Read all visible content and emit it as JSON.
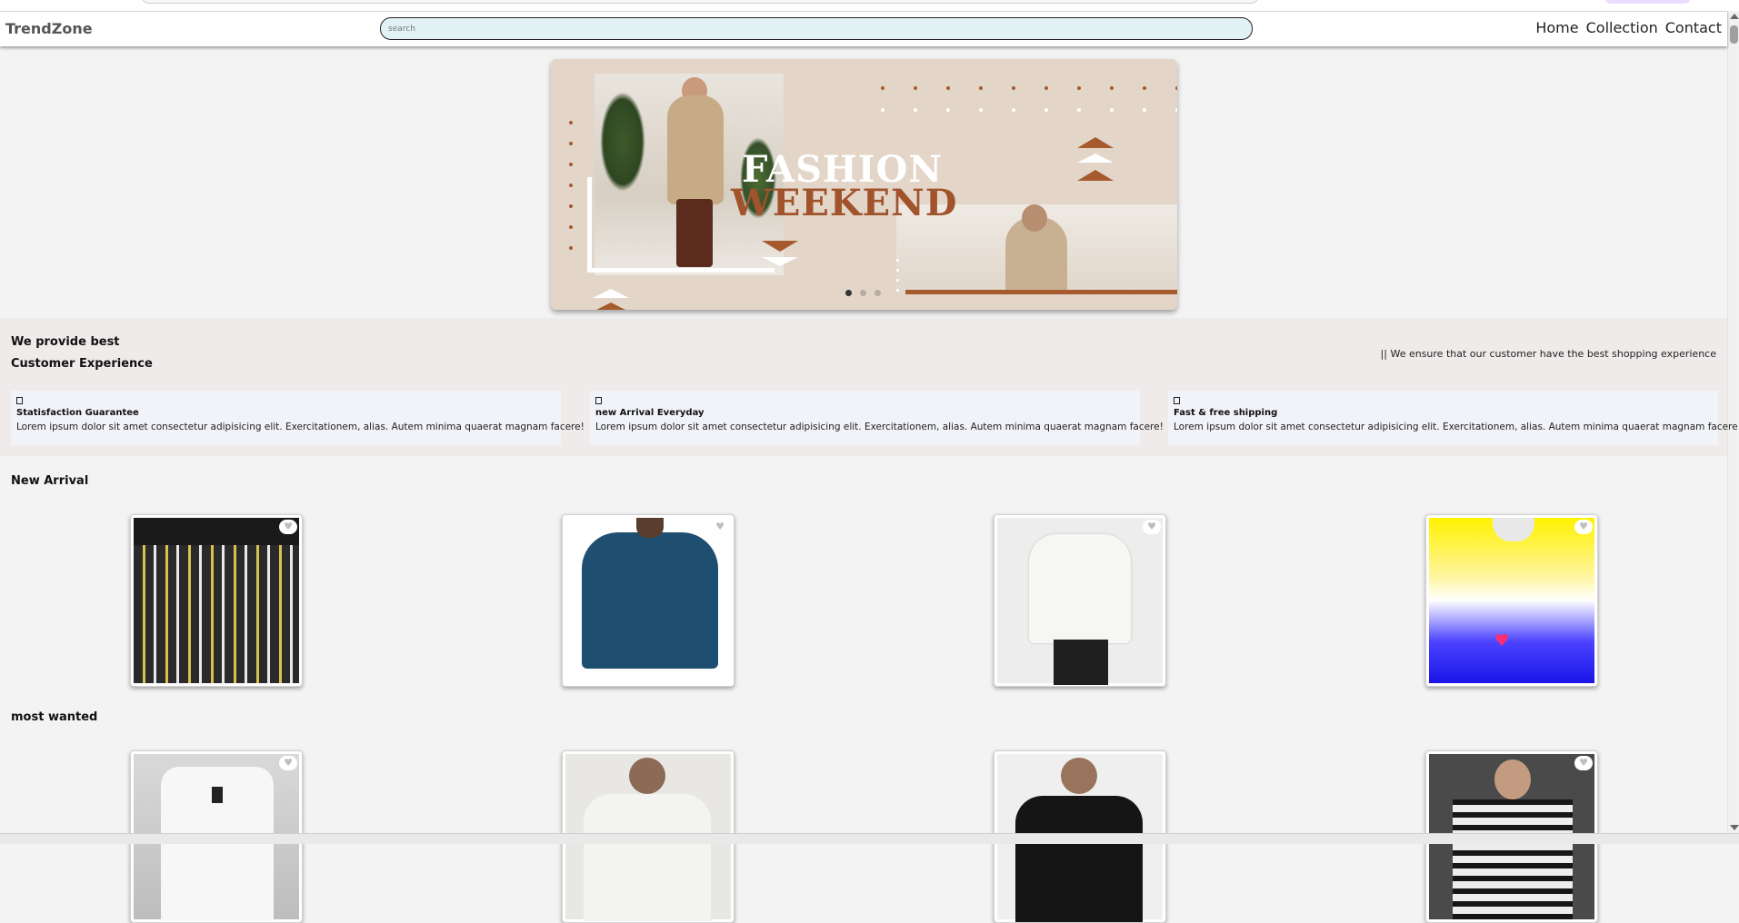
{
  "navbar": {
    "brand": "TrendZone",
    "search_placeholder": "search",
    "links": [
      "Home",
      "Collection",
      "Contact"
    ]
  },
  "hero": {
    "title_line1": "FASHION",
    "title_line2": "WEEKEND",
    "slides_count": 3,
    "active_slide": 1,
    "colors": {
      "background": "#e3d6c8",
      "accent": "#a1532b"
    }
  },
  "experience": {
    "heading_line1": "We provide best",
    "heading_line2": "Customer Experience",
    "tagline": "|| We ensure that our customer have the best shopping experience",
    "features": [
      {
        "icon": "guarantee-icon",
        "title": "Statisfaction Guarantee",
        "description": "Lorem ipsum dolor sit amet consectetur adipisicing elit. Exercitationem, alias. Autem minima quaerat magnam facere!"
      },
      {
        "icon": "new-arrival-icon",
        "title": "new Arrival Everyday",
        "description": "Lorem ipsum dolor sit amet consectetur adipisicing elit. Exercitationem, alias. Autem minima quaerat magnam facere!"
      },
      {
        "icon": "shipping-icon",
        "title": "Fast & free shipping",
        "description": "Lorem ipsum dolor sit amet consectetur adipisicing elit. Exercitationem, alias. Autem minima quaerat magnam facere!"
      }
    ]
  },
  "sections": {
    "new_arrival": {
      "title": "New Arrival"
    },
    "most_wanted": {
      "title": "most wanted"
    }
  },
  "icons": {
    "favorite": "♥"
  }
}
